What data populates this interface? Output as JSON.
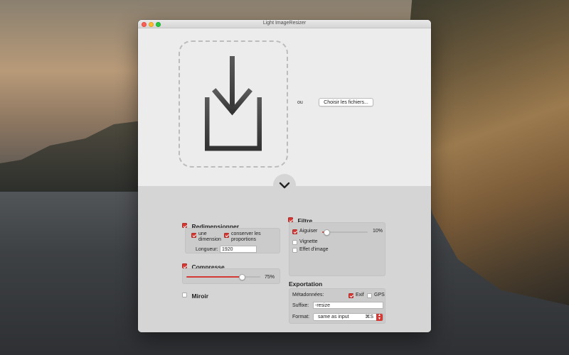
{
  "window": {
    "title": "Light ImageResizer"
  },
  "drop": {
    "or_label": "ou",
    "choose_button": "Choisir les fichiers..."
  },
  "resize": {
    "label": "Redimensionner",
    "checked": true,
    "one_dimension": {
      "label_line1": "une",
      "label_line2": "dimension",
      "checked": true
    },
    "keep_proportions": {
      "label_line1": "conserver les",
      "label_line2": "proportions",
      "checked": true
    },
    "length_label": "Longueur:",
    "length_value": "1920"
  },
  "compress": {
    "label": "Compresse",
    "checked": true,
    "value": 0.75,
    "value_label": "75%"
  },
  "mirror": {
    "label": "Miroir",
    "checked": false
  },
  "filter": {
    "label": "Filtre",
    "checked": true,
    "sharpen": {
      "label": "Aiguiser",
      "checked": true,
      "value": 0.1,
      "value_label": "10%"
    },
    "vignette": {
      "label": "Vignette",
      "checked": false
    },
    "image_effect": {
      "label": "Effet d'image",
      "checked": false
    }
  },
  "export": {
    "label": "Exportation",
    "metadata_label": "Métadonnées:",
    "exif": {
      "label": "Exif",
      "checked": true
    },
    "gps": {
      "label": "GPS",
      "checked": false
    },
    "suffix_label": "Suffixe:",
    "suffix_value": "-resize",
    "format_label": "Format:",
    "format_value": "same as input",
    "format_shortcut": "⌘S"
  },
  "icons": {
    "drop_icon": "download-arrow-into-tray-icon",
    "toggle_icon": "chevron-down-icon",
    "select_icon": "up-down-arrows-icon"
  },
  "colors": {
    "accent": "#d33a35",
    "window_bg": "#ececec",
    "panel_bg": "#d5d5d5"
  }
}
